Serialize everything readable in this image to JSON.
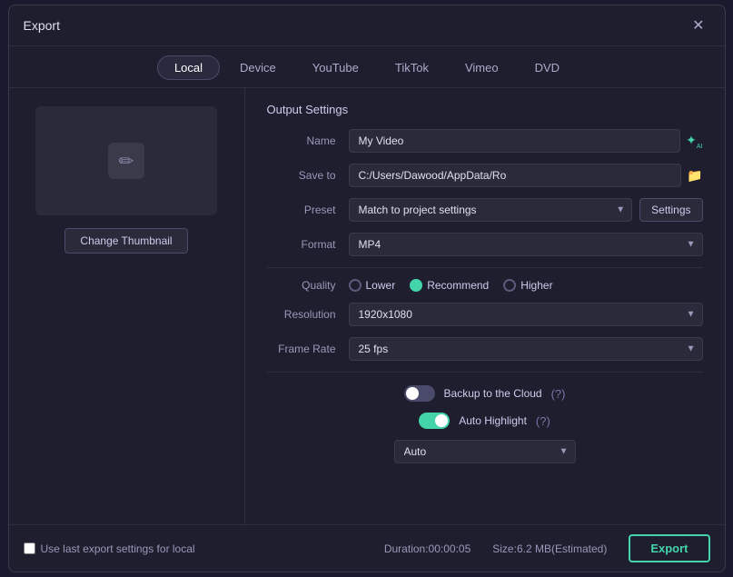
{
  "dialog": {
    "title": "Export",
    "close_label": "✕"
  },
  "tabs": [
    {
      "id": "local",
      "label": "Local",
      "active": true
    },
    {
      "id": "device",
      "label": "Device",
      "active": false
    },
    {
      "id": "youtube",
      "label": "YouTube",
      "active": false
    },
    {
      "id": "tiktok",
      "label": "TikTok",
      "active": false
    },
    {
      "id": "vimeo",
      "label": "Vimeo",
      "active": false
    },
    {
      "id": "dvd",
      "label": "DVD",
      "active": false
    }
  ],
  "thumbnail": {
    "change_label": "Change Thumbnail",
    "icon": "✏"
  },
  "output_settings": {
    "section_title": "Output Settings",
    "name_label": "Name",
    "name_value": "My Video",
    "save_to_label": "Save to",
    "save_to_value": "C:/Users/Dawood/AppData/Ro",
    "preset_label": "Preset",
    "preset_value": "Match to project settings",
    "settings_btn_label": "Settings",
    "format_label": "Format",
    "format_value": "MP4",
    "quality_label": "Quality",
    "quality_options": [
      {
        "id": "lower",
        "label": "Lower",
        "checked": false
      },
      {
        "id": "recommend",
        "label": "Recommend",
        "checked": true
      },
      {
        "id": "higher",
        "label": "Higher",
        "checked": false
      }
    ],
    "resolution_label": "Resolution",
    "resolution_value": "1920x1080",
    "frame_rate_label": "Frame Rate",
    "frame_rate_value": "25 fps"
  },
  "toggles": {
    "backup_cloud_label": "Backup to the Cloud",
    "backup_cloud_on": false,
    "auto_highlight_label": "Auto Highlight",
    "auto_highlight_on": true,
    "auto_select_value": "Auto"
  },
  "footer": {
    "use_last_settings_label": "Use last export settings for local",
    "duration_label": "Duration:",
    "duration_value": "00:00:05",
    "size_label": "Size:",
    "size_value": "6.2 MB(Estimated)",
    "export_label": "Export"
  }
}
